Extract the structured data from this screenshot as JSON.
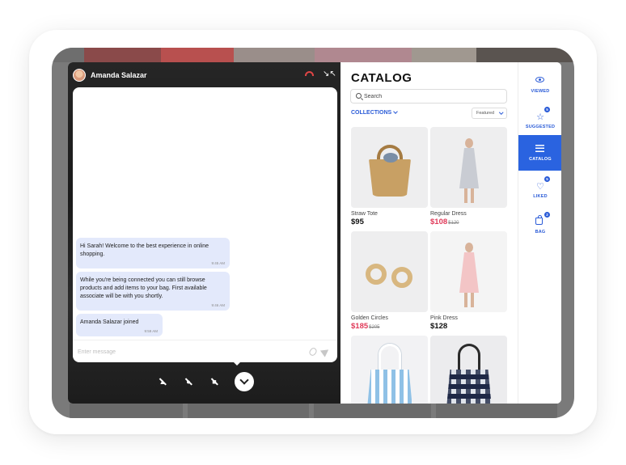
{
  "call": {
    "caller_name": "Amanda Salazar",
    "composer_placeholder": "Enter message",
    "messages": [
      {
        "text": "Hi Sarah! Welcome to the best experience in online shopping.",
        "time": "9:45 AM"
      },
      {
        "text": "While you're being connected you can still browse products and add items to your bag. First available associate will be with you shortly.",
        "time": "9:46 AM"
      },
      {
        "text": "Amanda Salazar joined",
        "time": "9:59 AM"
      }
    ]
  },
  "catalog": {
    "title": "CATALOG",
    "search_placeholder": "Search",
    "collections_label": "COLLECTIONS",
    "sort_label": "Featured",
    "products": [
      {
        "name": "Straw Tote",
        "price": "$95",
        "old_price": ""
      },
      {
        "name": "Regular Dress",
        "price": "$108",
        "old_price": "$120"
      },
      {
        "name": "Golden Circles",
        "price": "$185",
        "old_price": "$205"
      },
      {
        "name": "Pink Dress",
        "price": "$128",
        "old_price": ""
      },
      {
        "name": "",
        "price": "",
        "old_price": ""
      },
      {
        "name": "",
        "price": "",
        "old_price": ""
      }
    ]
  },
  "nav": {
    "items": [
      {
        "label": "VIEWED",
        "badge": ""
      },
      {
        "label": "SUGGESTED",
        "badge": "5"
      },
      {
        "label": "CATALOG",
        "badge": ""
      },
      {
        "label": "LIKED",
        "badge": "5"
      },
      {
        "label": "BAG",
        "badge": "2"
      }
    ]
  },
  "colors": {
    "accent": "#2a63e0",
    "sale": "#e03b5a",
    "hangup": "#e04545"
  }
}
